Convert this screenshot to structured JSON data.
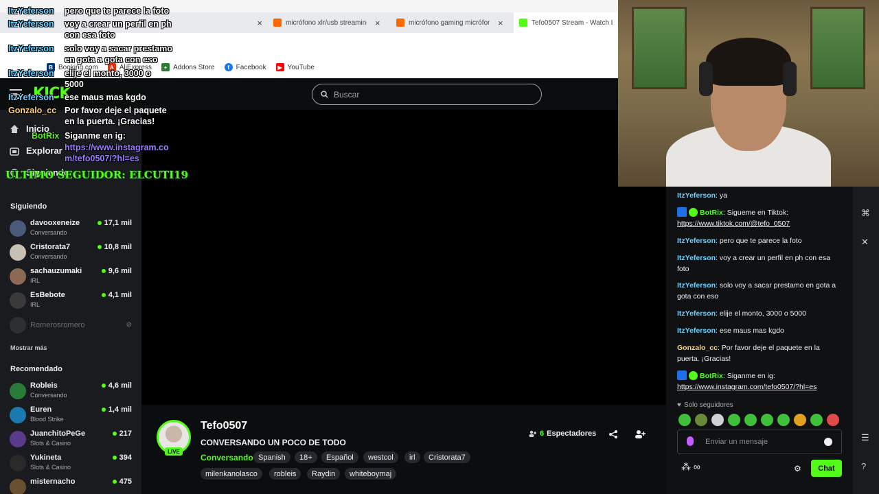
{
  "browser": {
    "tabs": [
      {
        "title": "micrófono xlr/usb streaming",
        "color": "#ff6a00"
      },
      {
        "title": "micrófono gaming micrófono",
        "color": "#ff6a00"
      },
      {
        "title": "Tefo0507 Stream - Watch Live",
        "color": "#53fc18"
      }
    ],
    "bookmarks": [
      {
        "label": "Booking.com",
        "color": "#003580",
        "glyph": "B"
      },
      {
        "label": "AliExpress",
        "color": "#e62e04",
        "glyph": "A"
      },
      {
        "label": "Addons Store",
        "color": "#2e7d32",
        "glyph": "+"
      },
      {
        "label": "Facebook",
        "color": "#1877f2",
        "glyph": "f"
      },
      {
        "label": "YouTube",
        "color": "#ff0000",
        "glyph": "▶"
      }
    ]
  },
  "kick": {
    "logo": "KICK",
    "search_placeholder": "Buscar",
    "nav": [
      {
        "label": "Inicio",
        "icon": "home-icon"
      },
      {
        "label": "Explorar",
        "icon": "explore-icon"
      },
      {
        "label": "Siguiendo",
        "icon": "following-icon"
      }
    ]
  },
  "sidebar": {
    "following_header": "Siguiendo",
    "following": [
      {
        "name": "davooxeneize",
        "category": "Conversando",
        "viewers": "17,1 mil"
      },
      {
        "name": "Cristorata7",
        "category": "Conversando",
        "viewers": "10,8 mil"
      },
      {
        "name": "sachauzumaki",
        "category": "IRL",
        "viewers": "9,6 mil"
      },
      {
        "name": "EsBebote",
        "category": "IRL",
        "viewers": "4,1 mil"
      }
    ],
    "offline": "Romerosromero",
    "show_more": "Mostrar más",
    "recommended_header": "Recomendado",
    "recommended": [
      {
        "name": "Robleis",
        "category": "Conversando",
        "viewers": "4,6 mil"
      },
      {
        "name": "Euren",
        "category": "Blood Strike",
        "viewers": "1,4 mil"
      },
      {
        "name": "JuanchitoPeGe",
        "category": "Slots & Casino",
        "viewers": "217"
      },
      {
        "name": "Yukineta",
        "category": "Slots & Casino",
        "viewers": "394"
      },
      {
        "name": "misternacho",
        "category": "",
        "viewers": "475"
      }
    ]
  },
  "stream": {
    "streamer": "Tefo0507",
    "live": "LIVE",
    "title": "CONVERSANDO UN POCO DE TODO",
    "category": "Conversando",
    "tags": [
      "Spanish",
      "18+",
      "Español",
      "westcol",
      "irl",
      "Cristorata7",
      "milenkanolasco",
      "robleis",
      "Raydin",
      "whiteboymaj"
    ],
    "viewers_count": "6",
    "viewers_label": "Espectadores"
  },
  "chat": {
    "messages": [
      {
        "user": "ItzYeferson",
        "color": "#6cd0ff",
        "text": "ya"
      },
      {
        "user": "BotRix",
        "color": "#53fc18",
        "text": "Sigueme en Tiktok:",
        "link": "https://www.tiktok.com/@tefo_0507",
        "bot": true
      },
      {
        "user": "ItzYeferson",
        "color": "#6cd0ff",
        "text": "pero que te parece la foto"
      },
      {
        "user": "ItzYeferson",
        "color": "#6cd0ff",
        "text": "voy a crear un perfil en ph con esa foto"
      },
      {
        "user": "ItzYeferson",
        "color": "#6cd0ff",
        "text": "solo voy a sacar prestamo en gota a gota con eso"
      },
      {
        "user": "ItzYeferson",
        "color": "#6cd0ff",
        "text": "elije el monto, 3000 o 5000"
      },
      {
        "user": "ItzYeferson",
        "color": "#6cd0ff",
        "text": "ese maus mas kgdo"
      },
      {
        "user": "Gonzalo_cc",
        "color": "#ffd27a",
        "text": "Por favor deje el paquete en la puerta. ¡Gracias!"
      },
      {
        "user": "BotRix",
        "color": "#53fc18",
        "text": "Siganme en ig:",
        "link": "https://www.instagram.com/tefo0507/?hl=es",
        "bot": true
      }
    ],
    "followers_only": "Solo seguidores",
    "input_placeholder": "Enviar un mensaje",
    "send_label": "Chat"
  },
  "overlay": {
    "lines": [
      {
        "user": "ItzYeferson",
        "text": "pero que te parece la foto"
      },
      {
        "user": "ItzYeferson",
        "text": "voy a crear un perfil en ph con esa foto"
      },
      {
        "user": "ItzYeferson",
        "text": "solo voy a sacar prestamo en gota a gota con eso"
      },
      {
        "user": "ItzYeferson",
        "text": "elije el monto, 3000 o 5000"
      },
      {
        "user": "ItzYeferson",
        "text": "ese maus mas kgdo"
      },
      {
        "user": "Gonzalo_cc",
        "text": "Por favor deje el paquete en la puerta. ¡Gracias!"
      },
      {
        "user": "BotRix",
        "text": "Siganme en ig:",
        "link": "https://www.instagram.com/tefo0507/?hl=es"
      }
    ],
    "last_follower": "ULTIMO SEGUIDOR: ELCUTI19"
  }
}
